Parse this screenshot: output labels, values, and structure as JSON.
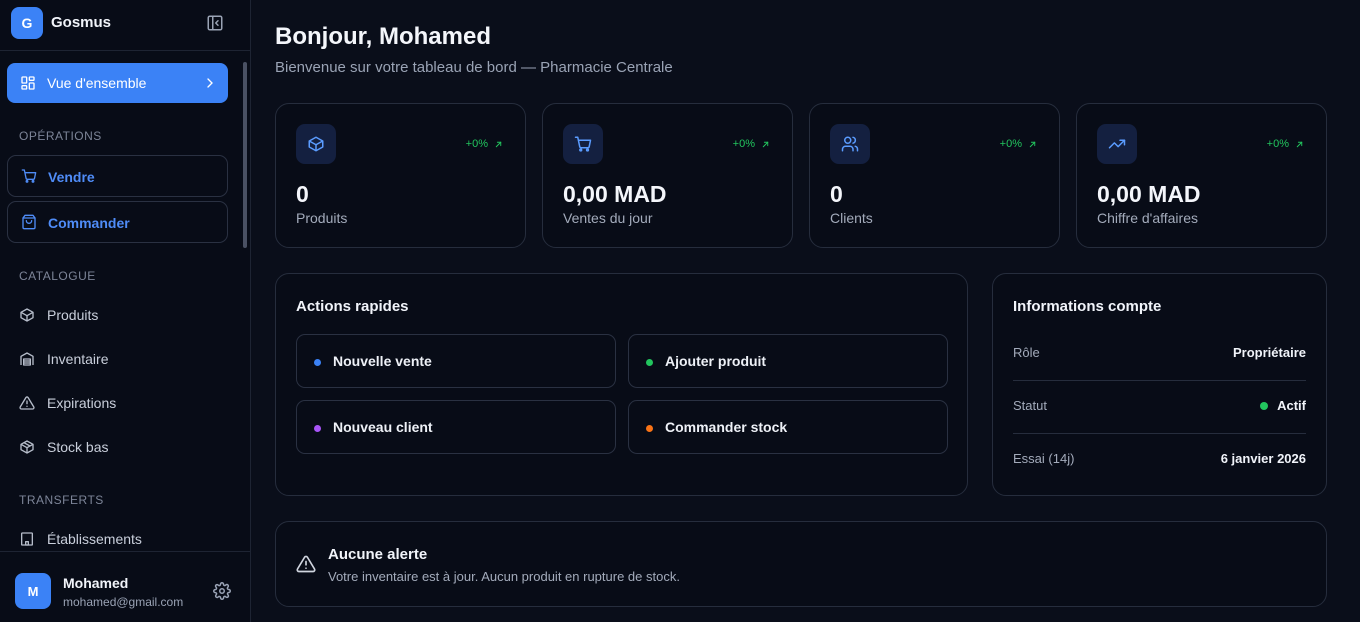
{
  "brand": {
    "initial": "G",
    "name": "Gosmus"
  },
  "sidebar": {
    "active_item": {
      "label": "Vue d'ensemble",
      "icon": "grid-icon"
    },
    "sections": [
      {
        "title": "OPÉRATIONS"
      },
      {
        "title": "CATALOGUE"
      },
      {
        "title": "TRANSFERTS"
      }
    ],
    "operations": [
      {
        "label": "Vendre",
        "icon": "cart-icon"
      },
      {
        "label": "Commander",
        "icon": "bag-icon"
      }
    ],
    "catalogue": [
      {
        "label": "Produits",
        "icon": "box-icon"
      },
      {
        "label": "Inventaire",
        "icon": "warehouse-icon"
      },
      {
        "label": "Expirations",
        "icon": "warning-icon"
      },
      {
        "label": "Stock bas",
        "icon": "boxes-icon"
      }
    ],
    "transferts": [
      {
        "label": "Établissements",
        "icon": "building-icon"
      }
    ]
  },
  "user": {
    "initial": "M",
    "name": "Mohamed",
    "email": "mohamed@gmail.com"
  },
  "header": {
    "greeting": "Bonjour, Mohamed",
    "subtitle": "Bienvenue sur votre tableau de bord — Pharmacie Centrale"
  },
  "stats": [
    {
      "value": "0",
      "label": "Produits",
      "trend": "+0%",
      "icon": "box-icon"
    },
    {
      "value": "0,00 MAD",
      "label": "Ventes du jour",
      "trend": "+0%",
      "icon": "cart-icon"
    },
    {
      "value": "0",
      "label": "Clients",
      "trend": "+0%",
      "icon": "users-icon"
    },
    {
      "value": "0,00 MAD",
      "label": "Chiffre d'affaires",
      "trend": "+0%",
      "icon": "trending-up-icon"
    }
  ],
  "quick_actions": {
    "title": "Actions rapides",
    "items": [
      {
        "label": "Nouvelle vente",
        "color": "#3b82f6"
      },
      {
        "label": "Ajouter produit",
        "color": "#22c55e"
      },
      {
        "label": "Nouveau client",
        "color": "#a855f7"
      },
      {
        "label": "Commander stock",
        "color": "#f97316"
      }
    ]
  },
  "account_info": {
    "title": "Informations compte",
    "rows": [
      {
        "key": "Rôle",
        "value": "Propriétaire"
      },
      {
        "key": "Statut",
        "value": "Actif"
      },
      {
        "key": "Essai (14j)",
        "value": "6 janvier 2026"
      }
    ]
  },
  "alert": {
    "title": "Aucune alerte",
    "text": "Votre inventaire est à jour. Aucun produit en rupture de stock."
  },
  "colors": {
    "accent": "#3b82f6",
    "success": "#22c55e",
    "background": "#0a0e1a"
  }
}
